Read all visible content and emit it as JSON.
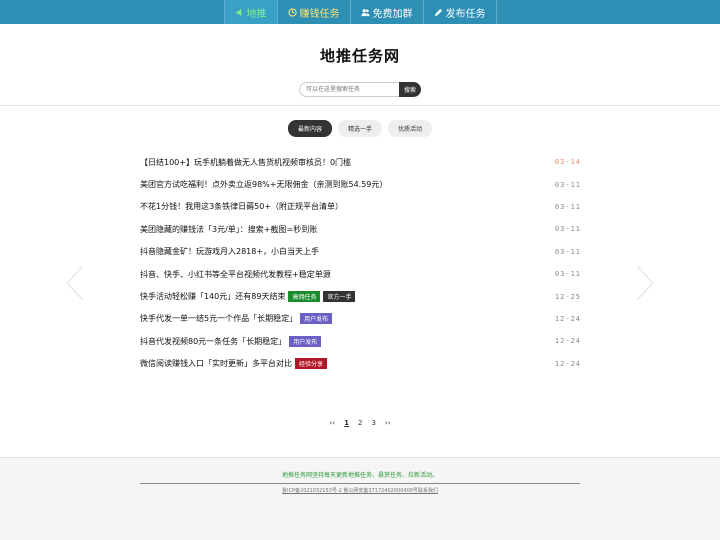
{
  "nav": [
    {
      "label": "地推",
      "icon": "megaphone-icon"
    },
    {
      "label": "赚钱任务",
      "icon": "clock-icon"
    },
    {
      "label": "免费加群",
      "icon": "users-icon"
    },
    {
      "label": "发布任务",
      "icon": "pencil-icon"
    }
  ],
  "site_title": "地推任务网",
  "search": {
    "placeholder": "可以在这里搜索任务",
    "button": "搜索"
  },
  "tabs": [
    "最新内容",
    "精选一手",
    "优质活动"
  ],
  "items": [
    {
      "title": "【日结100+】玩手机躺着做无人售货机视频审核员！0门槛",
      "date": "03-14",
      "tags": []
    },
    {
      "title": "美团官方试吃福利！点外卖立返98%+无限佣金（亲测到账54.59元）",
      "date": "03-11",
      "tags": []
    },
    {
      "title": "不花1分钱！我用这3条铁律日薅50+（附正规平台清单）",
      "date": "03-11",
      "tags": []
    },
    {
      "title": "美团隐藏的赚钱法「3元/单」：搜索+截图=秒到账",
      "date": "03-11",
      "tags": []
    },
    {
      "title": "抖音隐藏金矿！玩游戏月入2818+，小白当天上手",
      "date": "03-11",
      "tags": []
    },
    {
      "title": "抖音、快手、小红书等全平台视频代发教程+稳定单源",
      "date": "03-11",
      "tags": []
    },
    {
      "title": "快手活动轻松赚「140元」还有89天结束",
      "date": "12-25",
      "tags": [
        "高佣任务",
        "官方一手"
      ]
    },
    {
      "title": "快手代发一单一结5元一个作品「长期稳定」",
      "date": "12-24",
      "tags": [
        "用户发布"
      ]
    },
    {
      "title": "抖音代发视频80元一条任务「长期稳定」",
      "date": "12-24",
      "tags": [
        "用户发布"
      ]
    },
    {
      "title": "微信阅读赚钱入口「实时更新」多平台对比",
      "date": "12-24",
      "tags": [
        "经验分享"
      ]
    }
  ],
  "colors": {
    "nav_bg": "#2e8fb5",
    "date_recent": "#e98b63",
    "tag_高佣任务": "#1a8c2c",
    "tag_官方一手": "#333333",
    "tag_用户发布": "#6a5fc5",
    "tag_经验分享": "#b0182a"
  },
  "pager": {
    "prev": "‹‹",
    "pages": [
      "1",
      "2",
      "3"
    ],
    "current": "1",
    "next": "››"
  },
  "footer": {
    "slogan": "地推任务网坚持每天更新地推任务、悬赏任务、拉新活动。",
    "icp": "鲁ICP备2021032153号-2 鲁公网安备37172402000408号",
    "contact": "联系我们"
  }
}
